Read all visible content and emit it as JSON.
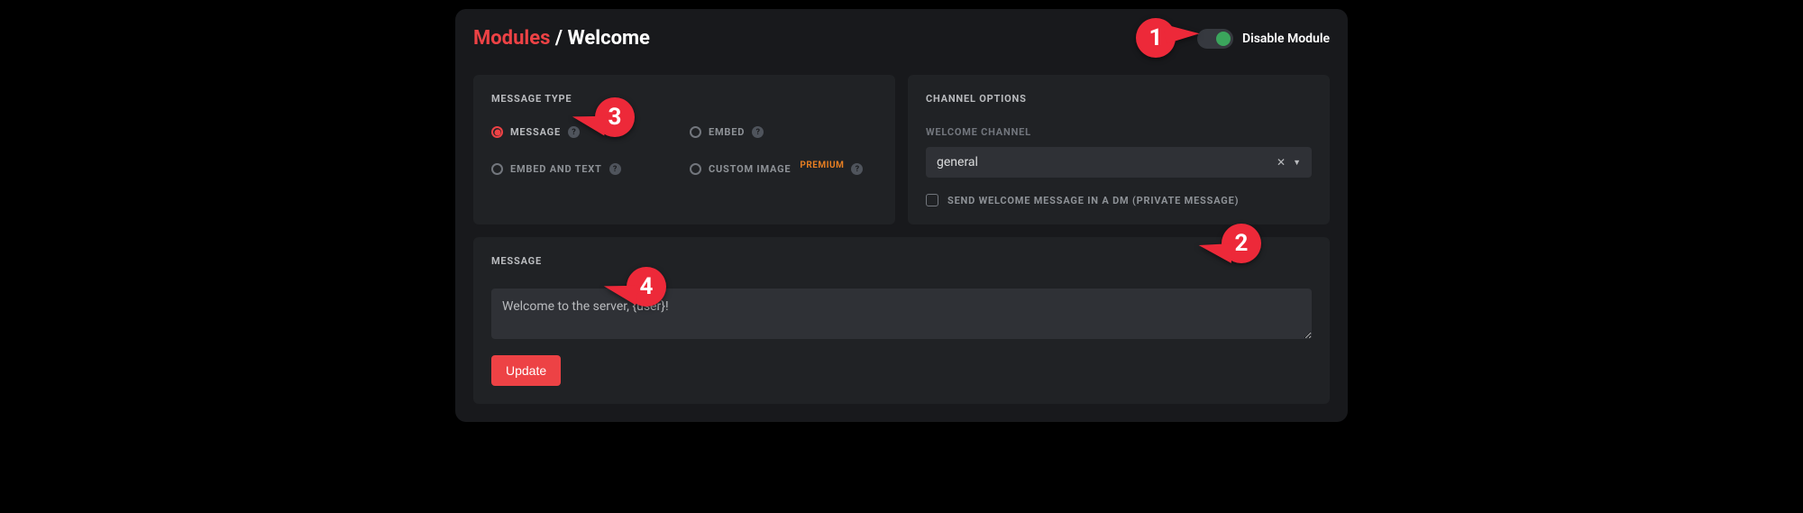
{
  "breadcrumb": {
    "modules": "Modules",
    "separator": " / ",
    "current": "Welcome"
  },
  "toggle": {
    "label": "Disable Module",
    "enabled": true
  },
  "message_type": {
    "title": "MESSAGE TYPE",
    "options": {
      "message": "MESSAGE",
      "embed": "EMBED",
      "embed_and_text": "EMBED AND TEXT",
      "custom_image": "CUSTOM IMAGE",
      "premium_badge": "PREMIUM"
    },
    "selected": "message"
  },
  "channel_options": {
    "title": "CHANNEL OPTIONS",
    "welcome_channel_label": "WELCOME CHANNEL",
    "welcome_channel_value": "general",
    "dm_checkbox_label": "SEND WELCOME MESSAGE IN A DM (PRIVATE MESSAGE)",
    "dm_checked": false
  },
  "message_section": {
    "title": "MESSAGE",
    "value": "Welcome to the server, {user}!",
    "update_button": "Update"
  },
  "callouts": {
    "1": "1",
    "2": "2",
    "3": "3",
    "4": "4"
  }
}
